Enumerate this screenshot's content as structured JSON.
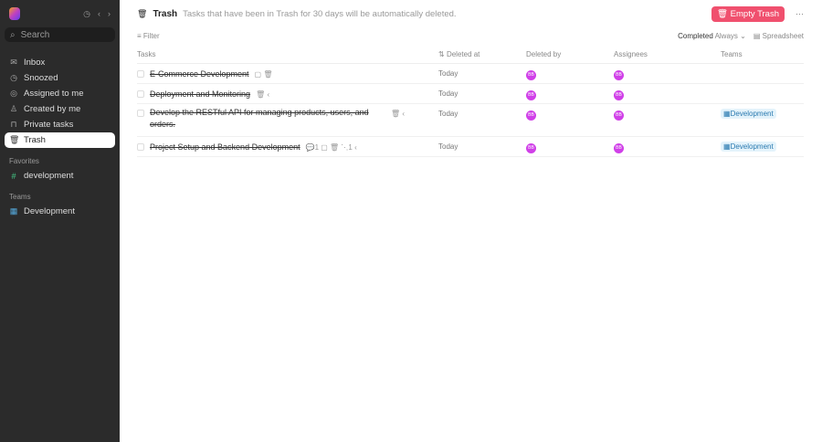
{
  "sidebar": {
    "search_placeholder": "Search",
    "items": [
      {
        "label": "Inbox",
        "icon": "inbox-icon"
      },
      {
        "label": "Snoozed",
        "icon": "clock-icon"
      },
      {
        "label": "Assigned to me",
        "icon": "target-icon"
      },
      {
        "label": "Created by me",
        "icon": "user-icon"
      },
      {
        "label": "Private tasks",
        "icon": "lock-icon"
      },
      {
        "label": "Trash",
        "icon": "trash-icon"
      }
    ],
    "favorites_label": "Favorites",
    "favorite": "development",
    "teams_label": "Teams",
    "team": "Development"
  },
  "header": {
    "title": "Trash",
    "description": "Tasks that have been in Trash for 30 days will be automatically deleted.",
    "empty_button": "Empty Trash"
  },
  "toolbar": {
    "filter": "Filter",
    "completed": "Completed",
    "always": "Always",
    "view": "Spreadsheet"
  },
  "columns": [
    "Tasks",
    "Deleted at",
    "Deleted by",
    "Assignees",
    "Teams"
  ],
  "rows": [
    {
      "name": "E-Commerce Development",
      "deleted_at": "Today",
      "deleted_by": "BB",
      "assignee": "BB",
      "team": "",
      "extra": "▢ 🗑"
    },
    {
      "name": "Deployment and Monitoring",
      "deleted_at": "Today",
      "deleted_by": "BB",
      "assignee": "BB",
      "team": "",
      "extra": "🗑 ‹"
    },
    {
      "name": "Develop the RESTful API for managing products, users, and orders.",
      "deleted_at": "Today",
      "deleted_by": "BB",
      "assignee": "BB",
      "team": "Development",
      "extra": "🗑 ‹"
    },
    {
      "name": "Project Setup and Backend Development",
      "deleted_at": "Today",
      "deleted_by": "BB",
      "assignee": "BB",
      "team": "Development",
      "extra": "💬1 ▢ 🗑 ⋱1 ‹"
    }
  ]
}
